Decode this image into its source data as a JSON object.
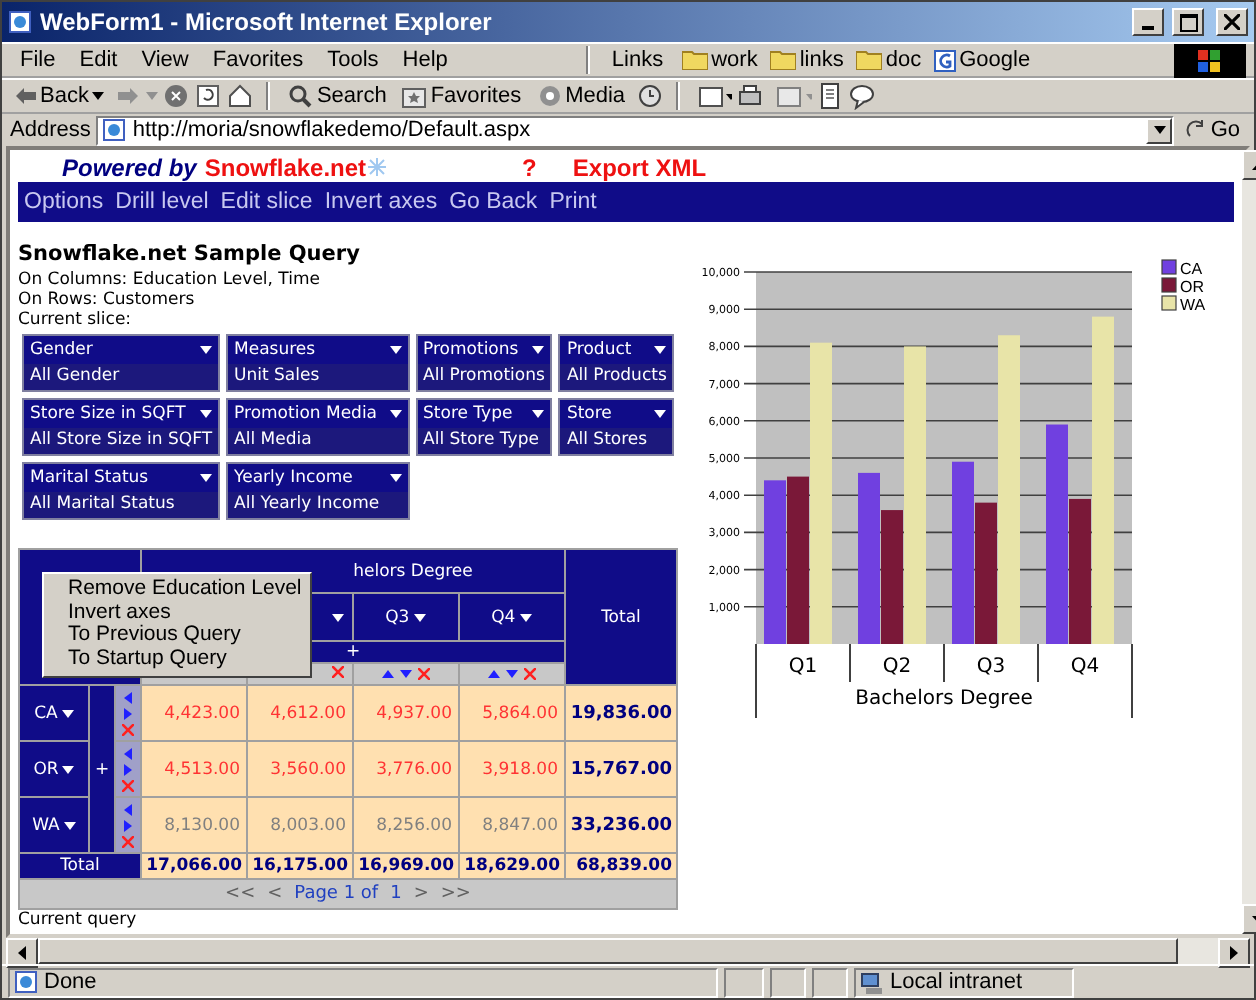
{
  "window": {
    "title": "WebForm1 - Microsoft Internet Explorer"
  },
  "menu_bar": [
    "File",
    "Edit",
    "View",
    "Favorites",
    "Tools",
    "Help"
  ],
  "links_bar": {
    "label": "Links",
    "items": [
      {
        "label": "work",
        "kind": "folder"
      },
      {
        "label": "links",
        "kind": "folder"
      },
      {
        "label": "doc",
        "kind": "folder"
      },
      {
        "label": "Google",
        "kind": "site"
      }
    ]
  },
  "toolbar": {
    "back": "Back",
    "search": "Search",
    "favorites": "Favorites",
    "media": "Media"
  },
  "address_bar": {
    "label": "Address",
    "value": "http://moria/snowflakedemo/Default.aspx",
    "go": "Go"
  },
  "page": {
    "powered_by": "Powered by",
    "brand": "Snowflake.net",
    "help": "?",
    "export": "Export XML",
    "nav": [
      "Options",
      "Drill level",
      "Edit slice",
      "Invert axes",
      "Go Back",
      "Print"
    ],
    "title": "Snowflake.net Sample Query",
    "columns_line": "On Columns: Education Level, Time",
    "rows_line": "On Rows: Customers",
    "slice_label": "Current slice:",
    "slicers": [
      {
        "dimension": "Gender",
        "member": "All Gender"
      },
      {
        "dimension": "Measures",
        "member": "Unit Sales"
      },
      {
        "dimension": "Promotions",
        "member": "All Promotions"
      },
      {
        "dimension": "Product",
        "member": "All Products"
      },
      {
        "dimension": "Store Size in SQFT",
        "member": "All Store Size in SQFT"
      },
      {
        "dimension": "Promotion Media",
        "member": "All Media"
      },
      {
        "dimension": "Store Type",
        "member": "All Store Type"
      },
      {
        "dimension": "Store",
        "member": "All Stores"
      },
      {
        "dimension": "Marital Status",
        "member": "All Marital Status"
      },
      {
        "dimension": "Yearly Income",
        "member": "All Yearly Income"
      }
    ],
    "pivot": {
      "column_header": "helors Degree",
      "quarters": [
        "Q3",
        "Q4"
      ],
      "expand": "+",
      "total_label": "Total",
      "row_total_label": "Total",
      "row_expand": "+",
      "rows": [
        {
          "label": "CA",
          "color": "#ff3333",
          "values": [
            "4,423.00",
            "4,612.00",
            "4,937.00",
            "5,864.00"
          ],
          "total": "19,836.00"
        },
        {
          "label": "OR",
          "color": "#ff3333",
          "values": [
            "4,513.00",
            "3,560.00",
            "3,776.00",
            "3,918.00"
          ],
          "total": "15,767.00"
        },
        {
          "label": "WA",
          "color": "#808080",
          "values": [
            "8,130.00",
            "8,003.00",
            "8,256.00",
            "8,847.00"
          ],
          "total": "33,236.00"
        }
      ],
      "totals": [
        "17,066.00",
        "16,175.00",
        "16,969.00",
        "18,629.00"
      ],
      "grand_total": "68,839.00",
      "pager": {
        "first": "<<",
        "prev": "<",
        "text": "Page 1 of",
        "page": "1",
        "next": ">",
        "last": ">>"
      }
    },
    "context_menu": [
      "Remove Education Level",
      "Invert axes",
      "To Previous Query",
      "To Startup Query"
    ],
    "chart": {
      "chart_data": {
        "type": "bar",
        "xlabel": "Bachelors Degree",
        "categories": [
          "Q1",
          "Q2",
          "Q3",
          "Q4"
        ],
        "series": [
          {
            "name": "CA",
            "color": "#7040e0",
            "values": [
              4400,
              4600,
              4900,
              5900
            ]
          },
          {
            "name": "OR",
            "color": "#7a1838",
            "values": [
              4500,
              3600,
              3800,
              3900
            ]
          },
          {
            "name": "WA",
            "color": "#e8e4a8",
            "values": [
              8100,
              8000,
              8300,
              8800
            ]
          }
        ],
        "grid": true,
        "legend": true,
        "ylim": [
          0,
          10000
        ],
        "yticks": [
          {
            "value": 1000,
            "label": "1,000"
          },
          {
            "value": 2000,
            "label": "2,000"
          },
          {
            "value": 3000,
            "label": "3,000"
          },
          {
            "value": 4000,
            "label": "4,000"
          },
          {
            "value": 5000,
            "label": "5,000"
          },
          {
            "value": 6000,
            "label": "6,000"
          },
          {
            "value": 7000,
            "label": "7,000"
          },
          {
            "value": 8000,
            "label": "8,000"
          },
          {
            "value": 9000,
            "label": "9,000"
          },
          {
            "value": 10000,
            "label": "10,000"
          }
        ]
      }
    },
    "current_query": "Current query"
  },
  "status_bar": {
    "text": "Done",
    "zone": "Local intranet"
  }
}
